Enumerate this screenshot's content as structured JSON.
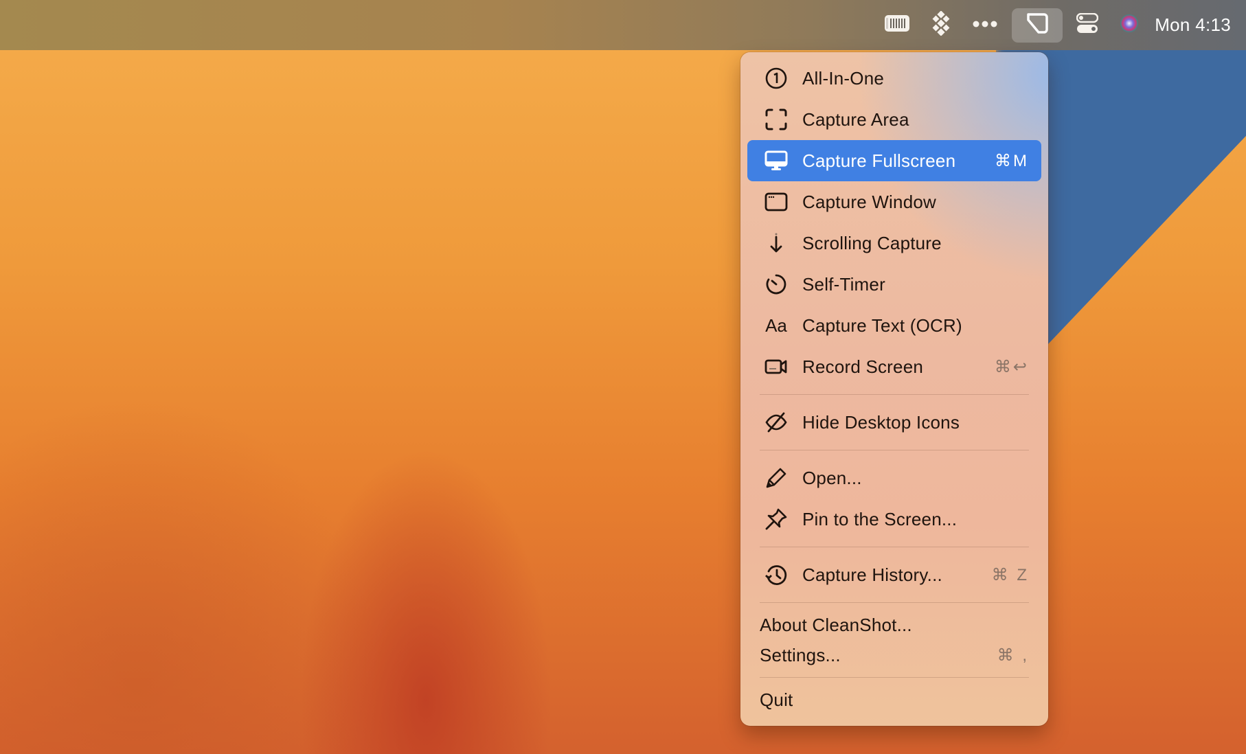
{
  "menubar": {
    "icons": [
      {
        "name": "barcode-icon"
      },
      {
        "name": "diamond-grid-icon"
      },
      {
        "name": "more-dots-icon"
      },
      {
        "name": "cleanshot-icon",
        "active": true
      },
      {
        "name": "control-center-icon"
      },
      {
        "name": "siri-icon"
      }
    ],
    "clock": "Mon 4:13"
  },
  "menu": {
    "items": [
      {
        "label": "All-In-One",
        "icon": "circled-one-icon",
        "shortcut": ""
      },
      {
        "label": "Capture Area",
        "icon": "capture-area-icon",
        "shortcut": ""
      },
      {
        "label": "Capture Fullscreen",
        "icon": "monitor-icon",
        "shortcut": "⌘M",
        "selected": true
      },
      {
        "label": "Capture Window",
        "icon": "window-icon",
        "shortcut": ""
      },
      {
        "label": "Scrolling Capture",
        "icon": "arrow-down-icon",
        "shortcut": ""
      },
      {
        "label": "Self-Timer",
        "icon": "timer-icon",
        "shortcut": ""
      },
      {
        "label": "Capture Text (OCR)",
        "icon": "text-aa-icon",
        "shortcut": ""
      },
      {
        "label": "Record Screen",
        "icon": "video-camera-icon",
        "shortcut": "⌘↩"
      },
      {
        "label": "Hide Desktop Icons",
        "icon": "eye-slash-icon",
        "shortcut": ""
      },
      {
        "label": "Open...",
        "icon": "pencil-icon",
        "shortcut": ""
      },
      {
        "label": "Pin to the Screen...",
        "icon": "pin-icon",
        "shortcut": ""
      },
      {
        "label": "Capture History...",
        "icon": "history-icon",
        "shortcut": "⌘ Z"
      },
      {
        "label": "About CleanShot...",
        "shortcut": ""
      },
      {
        "label": "Settings...",
        "shortcut": "⌘ ,"
      },
      {
        "label": "Quit",
        "shortcut": ""
      }
    ]
  },
  "colors": {
    "selection": "#4080e3"
  }
}
